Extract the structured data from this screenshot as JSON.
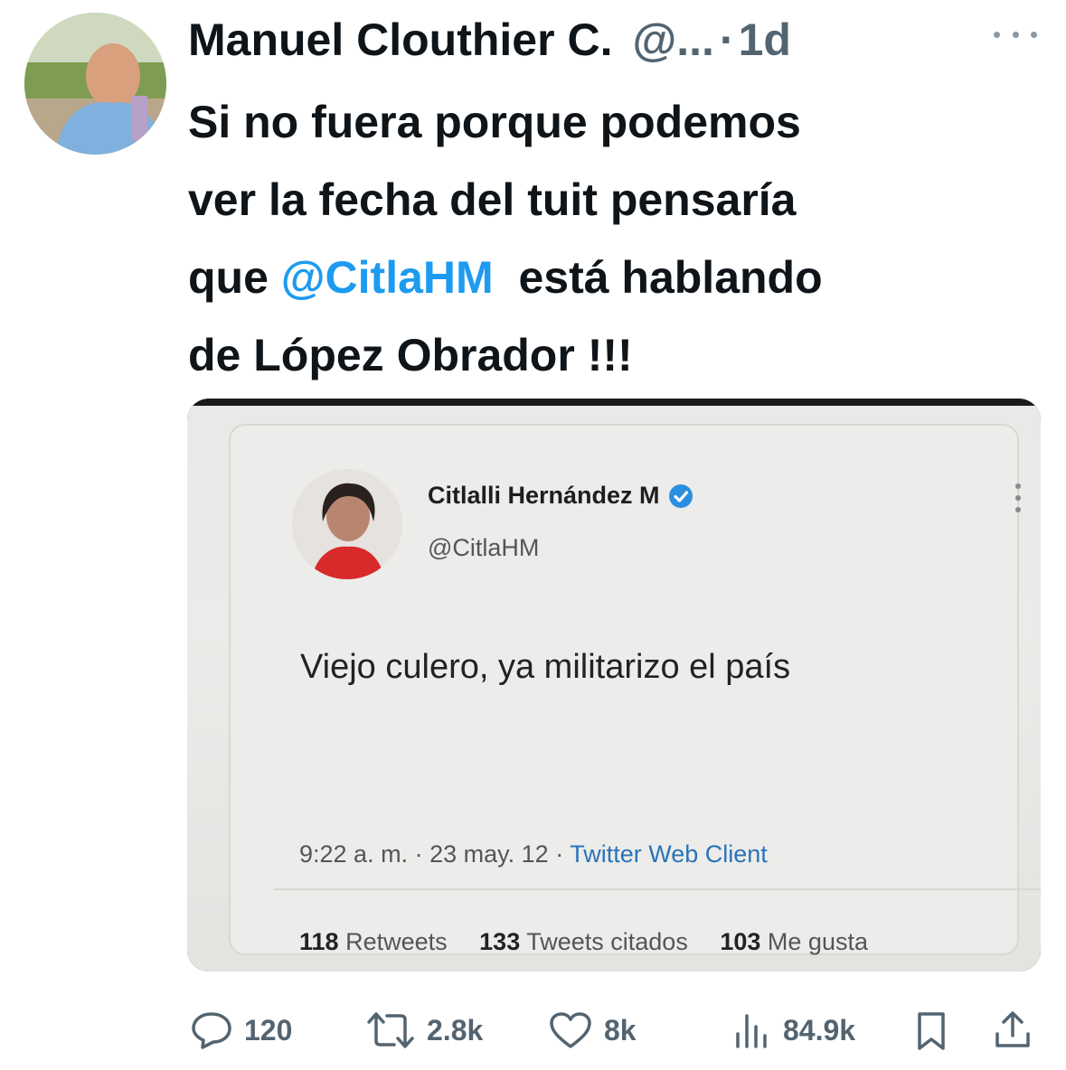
{
  "tweet": {
    "author_name": "Manuel Clouthier C.",
    "author_handle": "@...",
    "separator": "·",
    "time": "1d",
    "text_lines": [
      "Si no fuera porque podemos",
      "ver la fecha del tuit pensaría"
    ],
    "text_line3_before": "que ",
    "mention": "@CitlaHM",
    "text_line3_after": "  está hablando",
    "text_line4": "de López Obrador !!!"
  },
  "embedded": {
    "name": "Citlalli Hernández M",
    "handle": "@CitlaHM",
    "text": "Viejo culero, ya militarizo el país",
    "time": "9:22 a. m.",
    "date": "23 may. 12",
    "client": "Twitter Web Client",
    "stats": [
      {
        "count": "118",
        "label": "Retweets"
      },
      {
        "count": "133",
        "label": "Tweets citados"
      },
      {
        "count": "103",
        "label": "Me gusta"
      }
    ]
  },
  "actions": {
    "replies": "120",
    "retweets": "2.8k",
    "likes": "8k",
    "views": "84.9k"
  },
  "colors": {
    "accent": "#1d9bf0",
    "secondary_text": "#536471",
    "primary_text": "#0f1419"
  }
}
